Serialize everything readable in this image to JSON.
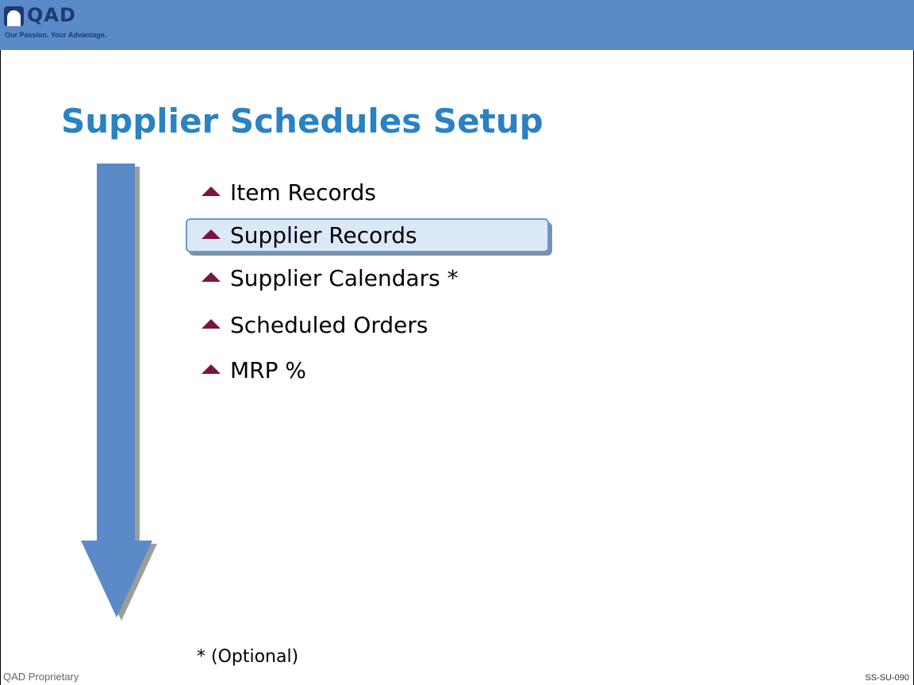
{
  "brand": {
    "name": "QAD",
    "tagline": "Our Passion. Your Advantage."
  },
  "slide": {
    "title": "Supplier Schedules Setup",
    "items": [
      {
        "label": "Item Records",
        "highlighted": false
      },
      {
        "label": "Supplier Records",
        "highlighted": true
      },
      {
        "label": "Supplier Calendars *",
        "highlighted": false
      },
      {
        "label": "Scheduled Orders",
        "highlighted": false
      },
      {
        "label": "MRP %",
        "highlighted": false
      }
    ],
    "footnote": "* (Optional)"
  },
  "footer": {
    "left": "QAD Proprietary",
    "right": "SS-SU-090"
  },
  "colors": {
    "header": "#5b8ac8",
    "title": "#2a82c2",
    "bullet": "#7a1440",
    "arrow": "#5b8ac8",
    "highlight_fill": "#dbe8f8",
    "highlight_border": "#6a98cf"
  }
}
